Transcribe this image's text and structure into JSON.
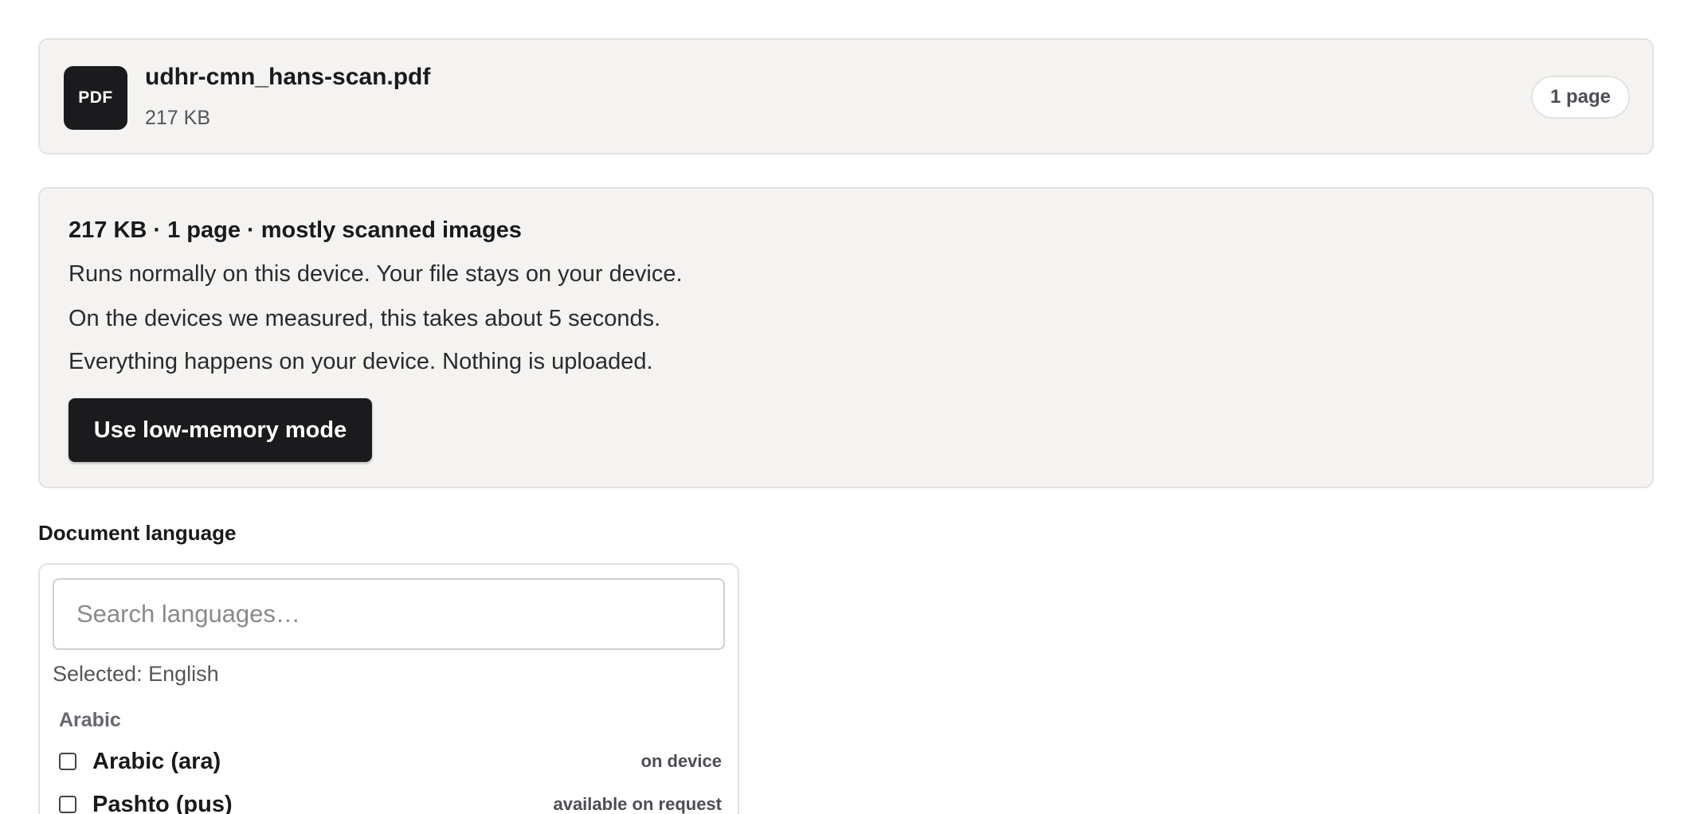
{
  "file": {
    "badge": "PDF",
    "name": "udhr-cmn_hans-scan.pdf",
    "size": "217 KB",
    "pages": "1 page"
  },
  "info": {
    "summary": "217 KB · 1 page · mostly scanned images",
    "lines": [
      "Runs normally on this device. Your file stays on your device.",
      "On the devices we measured, this takes about 5 seconds.",
      "Everything happens on your device. Nothing is uploaded."
    ],
    "button_label": "Use low-memory mode"
  },
  "language": {
    "section_label": "Document language",
    "search_placeholder": "Search languages…",
    "selected": "Selected: English",
    "groups": [
      {
        "label": "Arabic",
        "items": [
          {
            "name": "Arabic (ara)",
            "status": "on device",
            "checked": false
          },
          {
            "name": "Pashto (pus)",
            "status": "available on request",
            "checked": false
          }
        ]
      }
    ]
  },
  "colors": {
    "card_bg": "#f4f3f1",
    "card_border": "#e3e2df",
    "dark": "#1b1b1d",
    "muted_text": "#4d4d55"
  }
}
